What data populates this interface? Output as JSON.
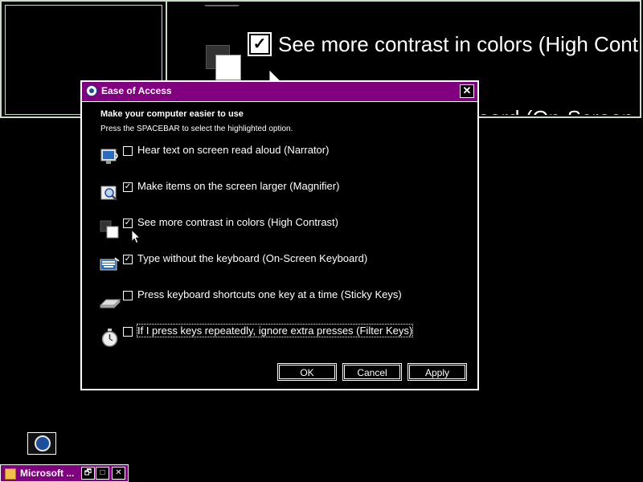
{
  "magnifier": {
    "text": "See more contrast in colors (High Cont",
    "text2": "board (On-Screen"
  },
  "dialog": {
    "title": "Ease of Access",
    "close_label": "✕",
    "heading": "Make your computer easier to use",
    "subheading": "Press the SPACEBAR to select the highlighted option.",
    "options": [
      {
        "label": "Hear text on screen read aloud (Narrator)",
        "checked": false,
        "icon": "narrator-icon"
      },
      {
        "label": "Make items on the screen larger (Magnifier)",
        "checked": true,
        "icon": "magnifier-icon"
      },
      {
        "label": "See more contrast in colors (High Contrast)",
        "checked": true,
        "icon": "high-contrast-icon"
      },
      {
        "label": "Type without the keyboard (On-Screen Keyboard)",
        "checked": true,
        "icon": "keyboard-icon"
      },
      {
        "label": "Press keyboard shortcuts one key at a time (Sticky Keys)",
        "checked": false,
        "icon": "sticky-keys-icon"
      },
      {
        "label": "If I press keys repeatedly, ignore extra presses (Filter Keys)",
        "checked": false,
        "icon": "filter-keys-icon"
      }
    ],
    "buttons": {
      "ok": "OK",
      "cancel": "Cancel",
      "apply": "Apply"
    }
  },
  "taskbar": {
    "label": "Microsoft ...",
    "restore": "🗗",
    "maximize": "□",
    "close": "✕"
  },
  "check_glyph": "✓",
  "colors": {
    "title_bar": "#800080",
    "background": "#000000",
    "text": "#ffffff"
  }
}
